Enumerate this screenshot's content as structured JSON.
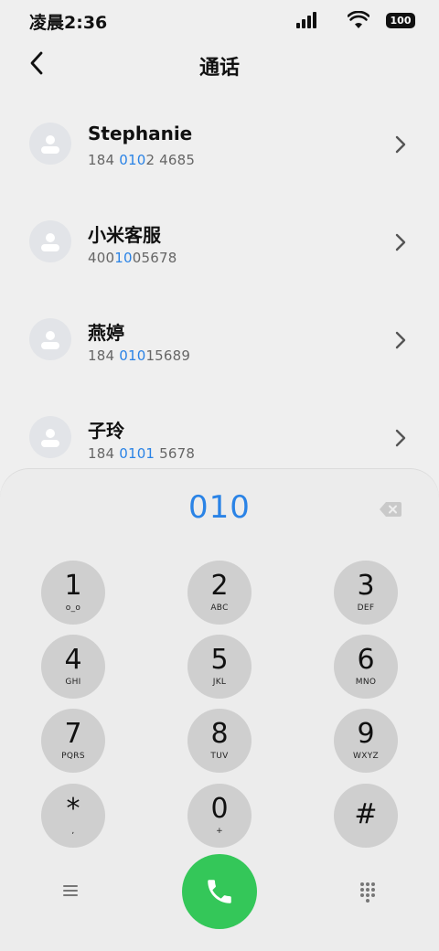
{
  "status_bar": {
    "time": "凌晨2:36",
    "battery": "100"
  },
  "header": {
    "title": "通话"
  },
  "contacts": [
    {
      "name": "Stephanie",
      "number_pre": "184 ",
      "number_match": "010",
      "number_post": "2 4685"
    },
    {
      "name": "小米客服",
      "number_pre": "400",
      "number_match": "10",
      "number_post": "05678"
    },
    {
      "name": "燕婷",
      "number_pre": "184 ",
      "number_match": "010",
      "number_post": "15689"
    },
    {
      "name": "子玲",
      "number_pre": "184 ",
      "number_match": "0101",
      "number_post": " 5678"
    }
  ],
  "dialpad": {
    "dialed": "010",
    "keys": [
      {
        "digit": "1",
        "letters": "o_o"
      },
      {
        "digit": "2",
        "letters": "ABC"
      },
      {
        "digit": "3",
        "letters": "DEF"
      },
      {
        "digit": "4",
        "letters": "GHI"
      },
      {
        "digit": "5",
        "letters": "JKL"
      },
      {
        "digit": "6",
        "letters": "MNO"
      },
      {
        "digit": "7",
        "letters": "PQRS"
      },
      {
        "digit": "8",
        "letters": "TUV"
      },
      {
        "digit": "9",
        "letters": "WXYZ"
      },
      {
        "digit": "*",
        "letters": ","
      },
      {
        "digit": "0",
        "letters": "+"
      },
      {
        "digit": "#",
        "letters": ""
      }
    ]
  },
  "colors": {
    "accent": "#2a83e6",
    "call": "#34c759",
    "key_bg": "#cfcfcf"
  },
  "icons": {
    "back": "chevron-left-icon",
    "backspace": "backspace-icon",
    "menu": "menu-icon",
    "call": "phone-icon",
    "keypad": "dialpad-icon"
  }
}
